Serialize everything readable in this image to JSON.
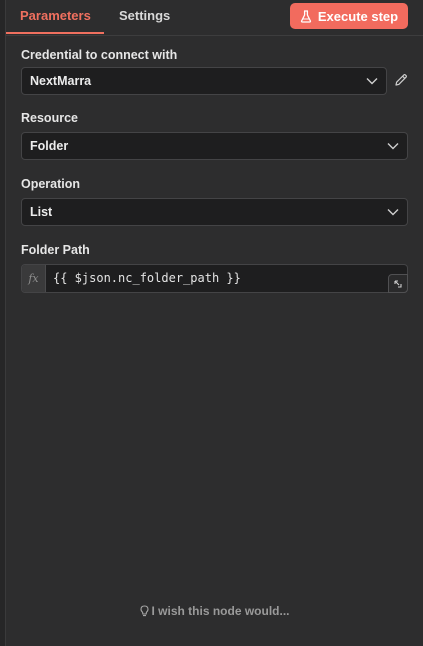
{
  "tabs": [
    {
      "label": "Parameters",
      "active": true
    },
    {
      "label": "Settings",
      "active": false
    }
  ],
  "execute_button": {
    "label": "Execute step",
    "icon": "flask-icon",
    "color": "#f26b5e"
  },
  "fields": {
    "credential": {
      "label": "Credential to connect with",
      "value": "NextMarra"
    },
    "resource": {
      "label": "Resource",
      "value": "Folder"
    },
    "operation": {
      "label": "Operation",
      "value": "List"
    },
    "folder_path": {
      "label": "Folder Path",
      "fx": "fx",
      "value": "{{ $json.nc_folder_path }}"
    }
  },
  "feedback": {
    "label": "I wish this node would..."
  },
  "colors": {
    "accent": "#f0705f",
    "background": "#2d2d2e",
    "input_bg": "#1e1e1f"
  }
}
